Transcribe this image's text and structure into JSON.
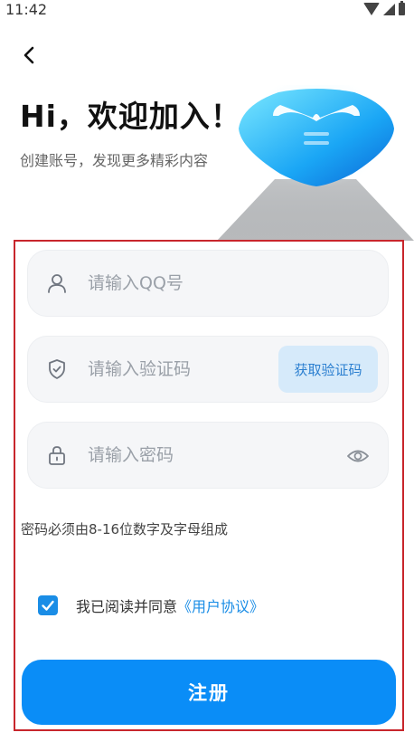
{
  "status_bar": {
    "time": "11:42",
    "icons": [
      "wifi-icon",
      "signal-icon",
      "battery-icon"
    ]
  },
  "header": {
    "back_icon": "chevron-left-icon",
    "title": "Hi，欢迎加入！",
    "subtitle": "创建账号，发现更多精彩内容"
  },
  "form": {
    "qq_field": {
      "placeholder": "请输入QQ号",
      "value": "",
      "icon": "user-icon"
    },
    "code_field": {
      "placeholder": "请输入验证码",
      "value": "",
      "icon": "shield-icon",
      "button_label": "获取验证码"
    },
    "password_field": {
      "placeholder": "请输入密码",
      "value": "",
      "icon": "lock-icon",
      "toggle_icon": "eye-icon"
    },
    "password_hint": "密码必须由8-16位数字及字母组成",
    "agreement": {
      "checked": true,
      "text": "我已阅读并同意",
      "link_text": "《用户协议》"
    },
    "submit_label": "注册"
  },
  "colors": {
    "accent": "#0a8df7",
    "link": "#1a8de6",
    "code_button_bg": "#d6eafa",
    "highlight_border": "#c8262c"
  }
}
